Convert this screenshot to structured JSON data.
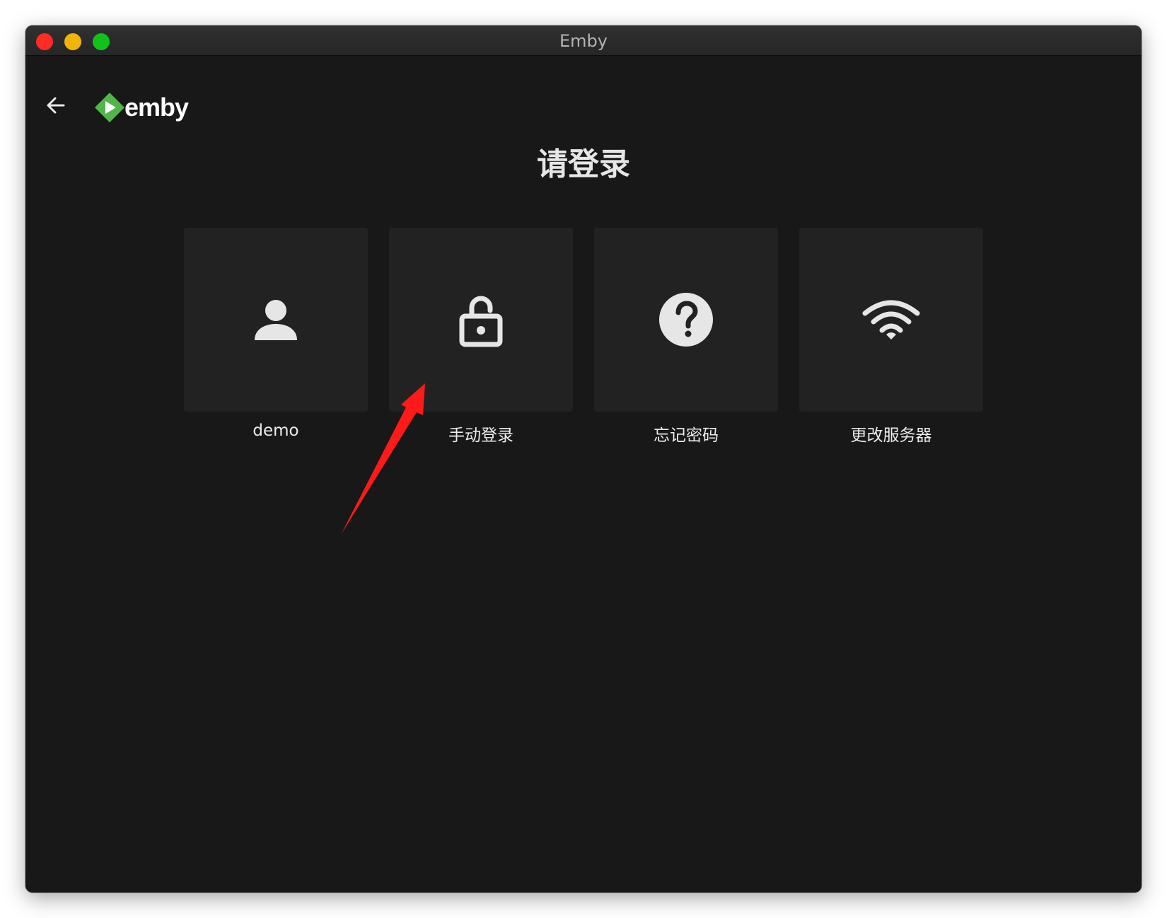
{
  "window": {
    "title": "Emby"
  },
  "header": {
    "logo_text": "emby",
    "brand_color": "#52b54b"
  },
  "page": {
    "title": "请登录"
  },
  "cards": [
    {
      "label": "demo",
      "icon": "user-icon"
    },
    {
      "label": "手动登录",
      "icon": "unlock-icon"
    },
    {
      "label": "忘记密码",
      "icon": "help-circle-icon"
    },
    {
      "label": "更改服务器",
      "icon": "wifi-icon"
    }
  ],
  "annotation": {
    "color": "#ff1a1a"
  }
}
